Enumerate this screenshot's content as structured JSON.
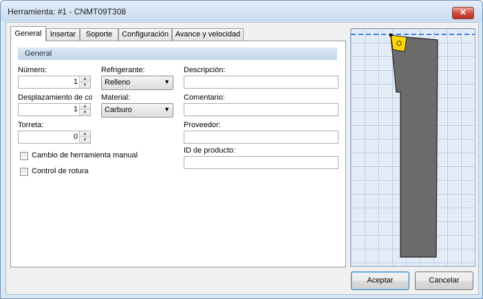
{
  "window": {
    "title": "Herramienta: #1 - CNMT09T308",
    "close_glyph": "✕"
  },
  "tabs": [
    "General",
    "Insertar",
    "Soporte",
    "Configuración",
    "Avance y velocidad"
  ],
  "active_tab": 0,
  "section": {
    "title": "General"
  },
  "fields": {
    "numero": {
      "label": "Número:",
      "value": "1"
    },
    "desplazamiento": {
      "label": "Desplazamiento de cor",
      "value": "1"
    },
    "torreta": {
      "label": "Torreta:",
      "value": "0"
    },
    "refrigerante": {
      "label": "Refrigerante:",
      "value": "Relleno"
    },
    "material": {
      "label": "Material:",
      "value": "Carburo"
    },
    "descripcion": {
      "label": "Descripción:",
      "value": ""
    },
    "comentario": {
      "label": "Comentario:",
      "value": ""
    },
    "proveedor": {
      "label": "Proveedor:",
      "value": ""
    },
    "id_producto": {
      "label": "ID de producto:",
      "value": ""
    }
  },
  "checkboxes": {
    "cambio_manual": {
      "label": "Cambio de herramienta manual",
      "checked": false
    },
    "control_rotura": {
      "label": "Control de rotura",
      "checked": false
    }
  },
  "buttons": {
    "ok": "Aceptar",
    "cancel": "Cancelar"
  },
  "icons": {
    "spin_up": "▲",
    "spin_down": "▼",
    "dropdown": "▼"
  },
  "colors": {
    "insert": "#ffd700",
    "holder": "#6b6b6b",
    "guide_line": "#3a7be0"
  }
}
